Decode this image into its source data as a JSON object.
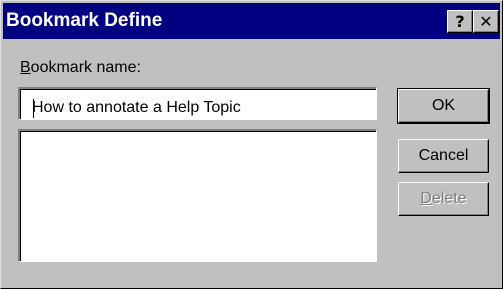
{
  "window": {
    "title": "Bookmark Define",
    "help_glyph": "?",
    "close_glyph": "✕"
  },
  "form": {
    "name_label_accel": "B",
    "name_label_rest": "ookmark name:",
    "name_value": "How to annotate a Help Topic",
    "bookmarks": []
  },
  "buttons": {
    "ok": "OK",
    "cancel": "Cancel",
    "delete_accel": "D",
    "delete_rest": "elete"
  },
  "colors": {
    "titlebar": "#000080",
    "face": "#c0c0c0"
  }
}
